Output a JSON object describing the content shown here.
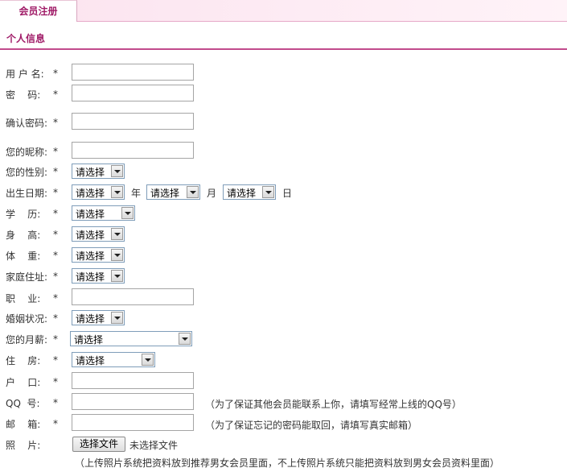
{
  "tab": {
    "label": "会员注册"
  },
  "section": {
    "title": "个人信息"
  },
  "fields": {
    "username": {
      "label": "用 户 名:",
      "required": "*",
      "value": ""
    },
    "password": {
      "label": "密    码:",
      "required": "*",
      "value": ""
    },
    "confirm_password": {
      "label": "确认密码:",
      "required": "*",
      "value": ""
    },
    "nickname": {
      "label": "您的昵称:",
      "required": "*",
      "value": ""
    },
    "gender": {
      "label": "您的性别:",
      "required": "*",
      "selected": "请选择"
    },
    "birthday": {
      "label": "出生日期:",
      "required": "*",
      "year_selected": "请选择",
      "year_unit": "年",
      "month_selected": "请选择",
      "month_unit": "月",
      "day_selected": "请选择",
      "day_unit": "日"
    },
    "education": {
      "label": "学    历:",
      "required": "*",
      "selected": "请选择"
    },
    "height": {
      "label": "身    高:",
      "required": "*",
      "selected": "请选择"
    },
    "weight": {
      "label": "体    重:",
      "required": "*",
      "selected": "请选择"
    },
    "home_address": {
      "label": "家庭住址:",
      "required": "*",
      "selected": "请选择"
    },
    "occupation": {
      "label": "职    业:",
      "required": "*",
      "value": ""
    },
    "marital_status": {
      "label": "婚姻状况:",
      "required": "*",
      "selected": "请选择"
    },
    "monthly_salary": {
      "label": "您的月薪:",
      "required": "*",
      "selected": "请选择"
    },
    "housing": {
      "label": "住    房:",
      "required": "*",
      "selected": "请选择"
    },
    "hukou": {
      "label": "户    口:",
      "required": "*",
      "value": ""
    },
    "qq": {
      "label": "QQ  号:",
      "required": "*",
      "value": "",
      "hint": "（为了保证其他会员能联系上你，请填写经常上线的QQ号）"
    },
    "email": {
      "label": "邮    箱:",
      "required": "*",
      "value": "",
      "hint": "（为了保证忘记的密码能取回，请填写真实邮箱）"
    },
    "photo": {
      "label": "照    片:",
      "button_label": "选择文件",
      "status": "未选择文件"
    }
  },
  "photo_note": "（上传照片系统把资料放到推荐男女会员里面，不上传照片系统只能把资料放到男女会员资料里面）"
}
